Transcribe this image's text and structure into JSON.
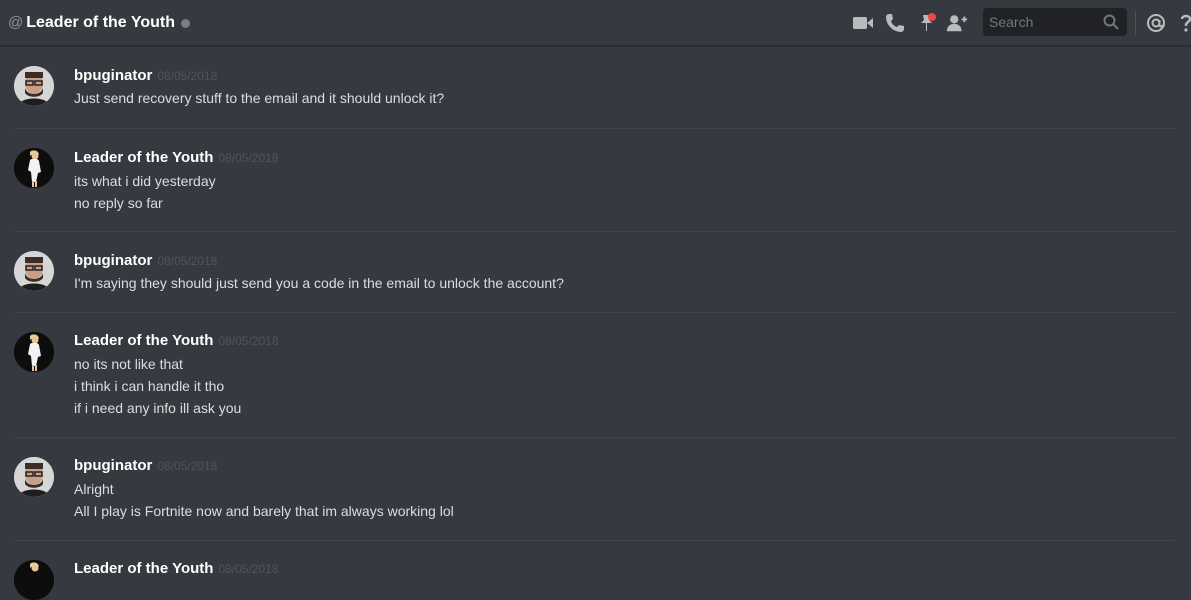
{
  "header": {
    "at_symbol": "@",
    "title": "Leader of the Youth",
    "search_placeholder": "Search",
    "icons": [
      "video-icon",
      "phone-icon",
      "pin-icon",
      "add-friend-icon",
      "search-icon",
      "mention-icon",
      "help-icon"
    ]
  },
  "messages": [
    {
      "author": "bpuginator",
      "timestamp": "08/05/2018",
      "lines": [
        "Just send recovery stuff to the email and it should unlock it?"
      ]
    },
    {
      "author": "Leader of the Youth",
      "timestamp": "08/05/2018",
      "lines": [
        "its what i did yesterday",
        "no reply so far"
      ]
    },
    {
      "author": "bpuginator",
      "timestamp": "08/05/2018",
      "lines": [
        "I'm saying they should just send you a code in the email to unlock the account?"
      ]
    },
    {
      "author": "Leader of the Youth",
      "timestamp": "08/05/2018",
      "lines": [
        "no its not like that",
        "i think i can handle it tho",
        "if i need any info ill ask you"
      ]
    },
    {
      "author": "bpuginator",
      "timestamp": "08/05/2018",
      "lines": [
        "Alright",
        "All I play is Fortnite now and barely that im always working lol"
      ]
    },
    {
      "author": "Leader of the Youth",
      "timestamp": "08/05/2018",
      "lines": []
    }
  ],
  "colors": {
    "background": "#36393f",
    "username": "#ffffff",
    "timestamp": "#4f545c",
    "text": "#dcddde",
    "notification": "#f04747"
  }
}
